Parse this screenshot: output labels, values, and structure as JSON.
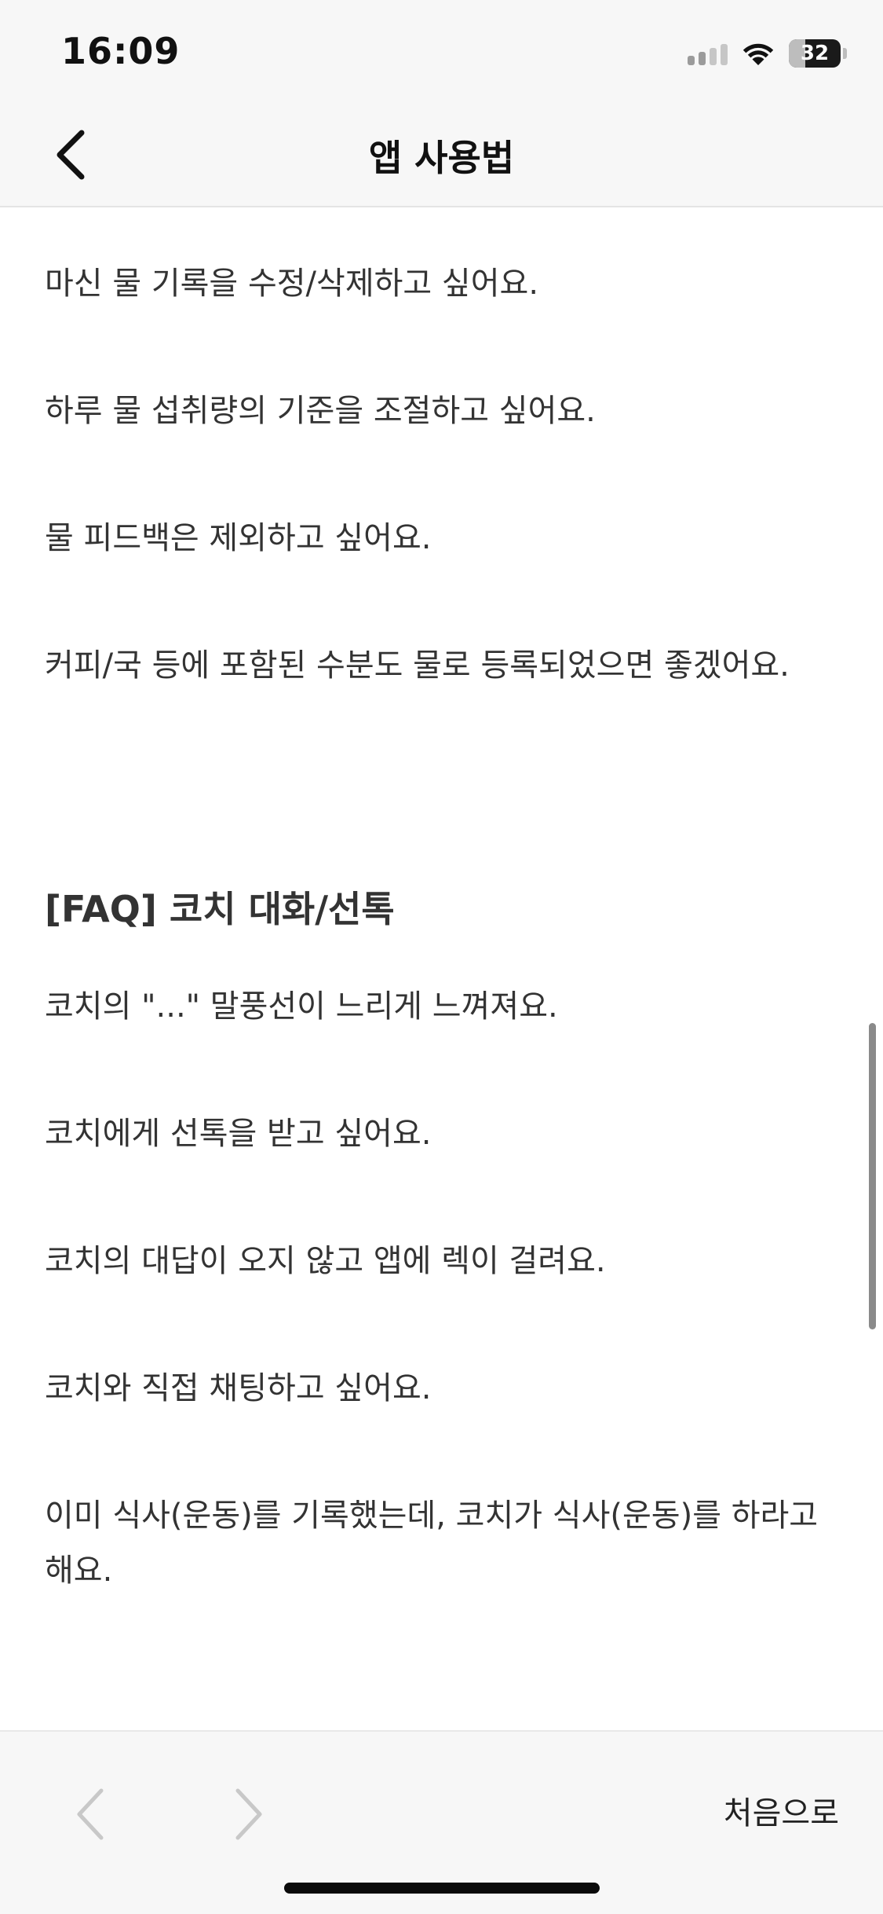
{
  "status_bar": {
    "time": "16:09",
    "battery_level": "32",
    "battery_fraction": 0.32,
    "icons": [
      "cellular-signal-icon",
      "wifi-icon",
      "battery-icon"
    ]
  },
  "header": {
    "title": "앱 사용법",
    "back_icon": "chevron-left-icon"
  },
  "content": {
    "items_before": [
      "마신 물 기록을 수정/삭제하고 싶어요.",
      "하루 물 섭취량의 기준을 조절하고 싶어요.",
      "물 피드백은 제외하고 싶어요.",
      "커피/국 등에 포함된 수분도 물로 등록되었으면 좋겠어요."
    ],
    "section_title": "[FAQ] 코치 대화/선톡",
    "section_items": [
      "코치의 \"...\" 말풍선이 느리게 느껴져요.",
      "코치에게 선톡을 받고 싶어요.",
      "코치의 대답이 오지 않고 앱에 렉이 걸려요.",
      "코치와 직접 채팅하고 싶어요.",
      "이미 식사(운동)를 기록했는데, 코치가 식사(운동)를 하라고 해요."
    ]
  },
  "toolbar": {
    "prev_icon": "chevron-left-icon",
    "next_icon": "chevron-right-icon",
    "go_first_label": "처음으로"
  },
  "colors": {
    "bar_background": "#f7f7f7",
    "text": "#333333",
    "disabled_chevron": "#c8c8c8"
  }
}
